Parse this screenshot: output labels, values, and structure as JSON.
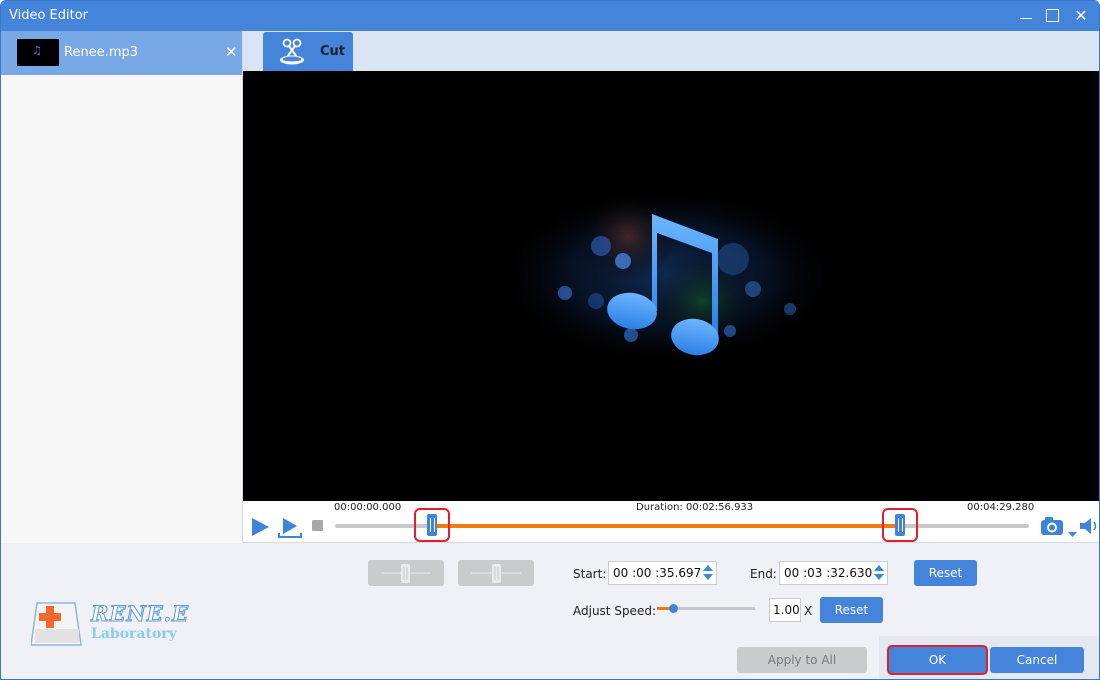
{
  "window": {
    "title": "Video Editor",
    "controls": {
      "minimize": "minimize",
      "maximize": "maximize",
      "close": "✕"
    }
  },
  "sidebar": {
    "files": [
      {
        "name": "Renee.mp3",
        "close": "✕"
      }
    ]
  },
  "tabs": [
    {
      "label": "Cut",
      "icon": "scissors-icon",
      "active": true
    }
  ],
  "preview": {
    "icon": "music-note-icon"
  },
  "timeline": {
    "start_time": "00:00:00.000",
    "duration_label": "Duration: 00:02:56.933",
    "end_time": "00:04:29.280",
    "selection_start_fraction": 0.1391,
    "selection_end_fraction": 0.8147,
    "highlight_color": "#e0202a",
    "accent_color": "#f37a0f"
  },
  "cut": {
    "start_label": "Start:",
    "start_value": "00 :00 :35.697",
    "end_label": "End:",
    "end_value": "00 :03 :32.630",
    "reset_label": "Reset"
  },
  "speed": {
    "label": "Adjust Speed:",
    "value": "1.00",
    "unit": "X",
    "slider_fraction": 0.16,
    "reset_label": "Reset"
  },
  "logo": {
    "brand": "RENE.E",
    "sub": "Laboratory"
  },
  "footer": {
    "apply_all": "Apply to All",
    "ok": "OK",
    "cancel": "Cancel"
  },
  "colors": {
    "primary": "#4484db",
    "titlebar": "#4484db",
    "disabled": "#cacbcd"
  }
}
